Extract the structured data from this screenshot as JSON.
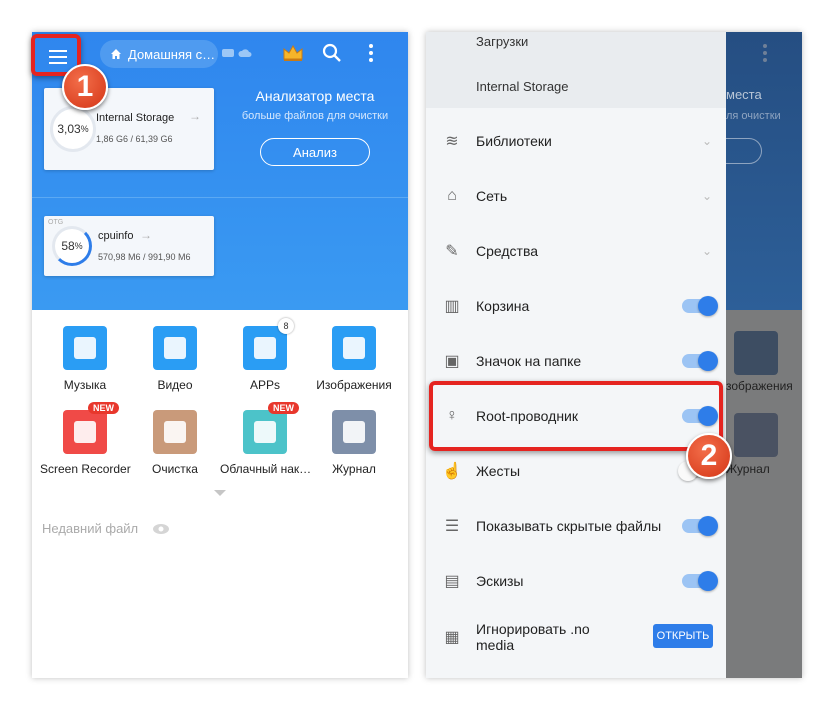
{
  "left": {
    "location_pill": "Домашняя с…",
    "storage_cards": [
      {
        "percent": "3,03",
        "unit": "%",
        "name": "Internal Storage",
        "size": "1,86 G6 / 61,39 G6"
      },
      {
        "percent": "58",
        "unit": "%",
        "name": "cpuinfo",
        "size": "570,98 M6 / 991,90 M6",
        "tag": "OTG"
      }
    ],
    "analyzer": {
      "title": "Анализатор места",
      "subtitle": "больше файлов для очистки",
      "button": "Анализ"
    },
    "apps": [
      {
        "label": "Музыка",
        "color": "#2a9df4",
        "icon": "music-note-icon"
      },
      {
        "label": "Видео",
        "color": "#2a9df4",
        "icon": "video-play-icon"
      },
      {
        "label": "APPs",
        "color": "#2a9df4",
        "icon": "android-icon",
        "count": "8"
      },
      {
        "label": "Изображения",
        "color": "#2a9df4",
        "icon": "image-icon"
      },
      {
        "label": "Screen Recorder",
        "color": "#f04a47",
        "icon": "camera-icon",
        "badge": "NEW"
      },
      {
        "label": "Очистка",
        "color": "#c99a7a",
        "icon": "broom-icon"
      },
      {
        "label": "Облачный нак…",
        "color": "#4cc3c9",
        "icon": "cloud-icon",
        "badge": "NEW"
      },
      {
        "label": "Журнал",
        "color": "#7e8fa9",
        "icon": "layers-clock-icon"
      }
    ],
    "recent": "Недавний файл"
  },
  "drawer": {
    "top_items": [
      "Загрузки",
      "Internal Storage"
    ],
    "items": [
      {
        "label": "Библиотеки",
        "icon": "layers-icon",
        "type": "expand"
      },
      {
        "label": "Сеть",
        "icon": "router-icon",
        "type": "expand"
      },
      {
        "label": "Средства",
        "icon": "wrench-icon",
        "type": "expand"
      },
      {
        "label": "Корзина",
        "icon": "trash-icon",
        "type": "toggle",
        "on": true
      },
      {
        "label": "Значок на папке",
        "icon": "folder-badge-icon",
        "type": "toggle",
        "on": true
      },
      {
        "label": "Root-проводник",
        "icon": "root-key-icon",
        "type": "toggle",
        "on": true
      },
      {
        "label": "Жесты",
        "icon": "gesture-hand-icon",
        "type": "toggle",
        "on": false
      },
      {
        "label": "Показывать скрытые файлы",
        "icon": "hidden-files-icon",
        "type": "toggle",
        "on": true
      },
      {
        "label": "Эскизы",
        "icon": "thumbnail-icon",
        "type": "toggle",
        "on": true
      },
      {
        "label": "Игнорировать .no",
        "label2": "media",
        "icon": "ignore-media-icon",
        "type": "button",
        "button": "ОТКРЫТЬ"
      }
    ]
  },
  "behind": {
    "title": "места",
    "subtitle": "ля очистки",
    "apps": [
      "зображения",
      "Журнал"
    ]
  },
  "markers": [
    "1",
    "2"
  ],
  "colors": {
    "accent": "#2e7de9",
    "highlight": "#e52420"
  }
}
